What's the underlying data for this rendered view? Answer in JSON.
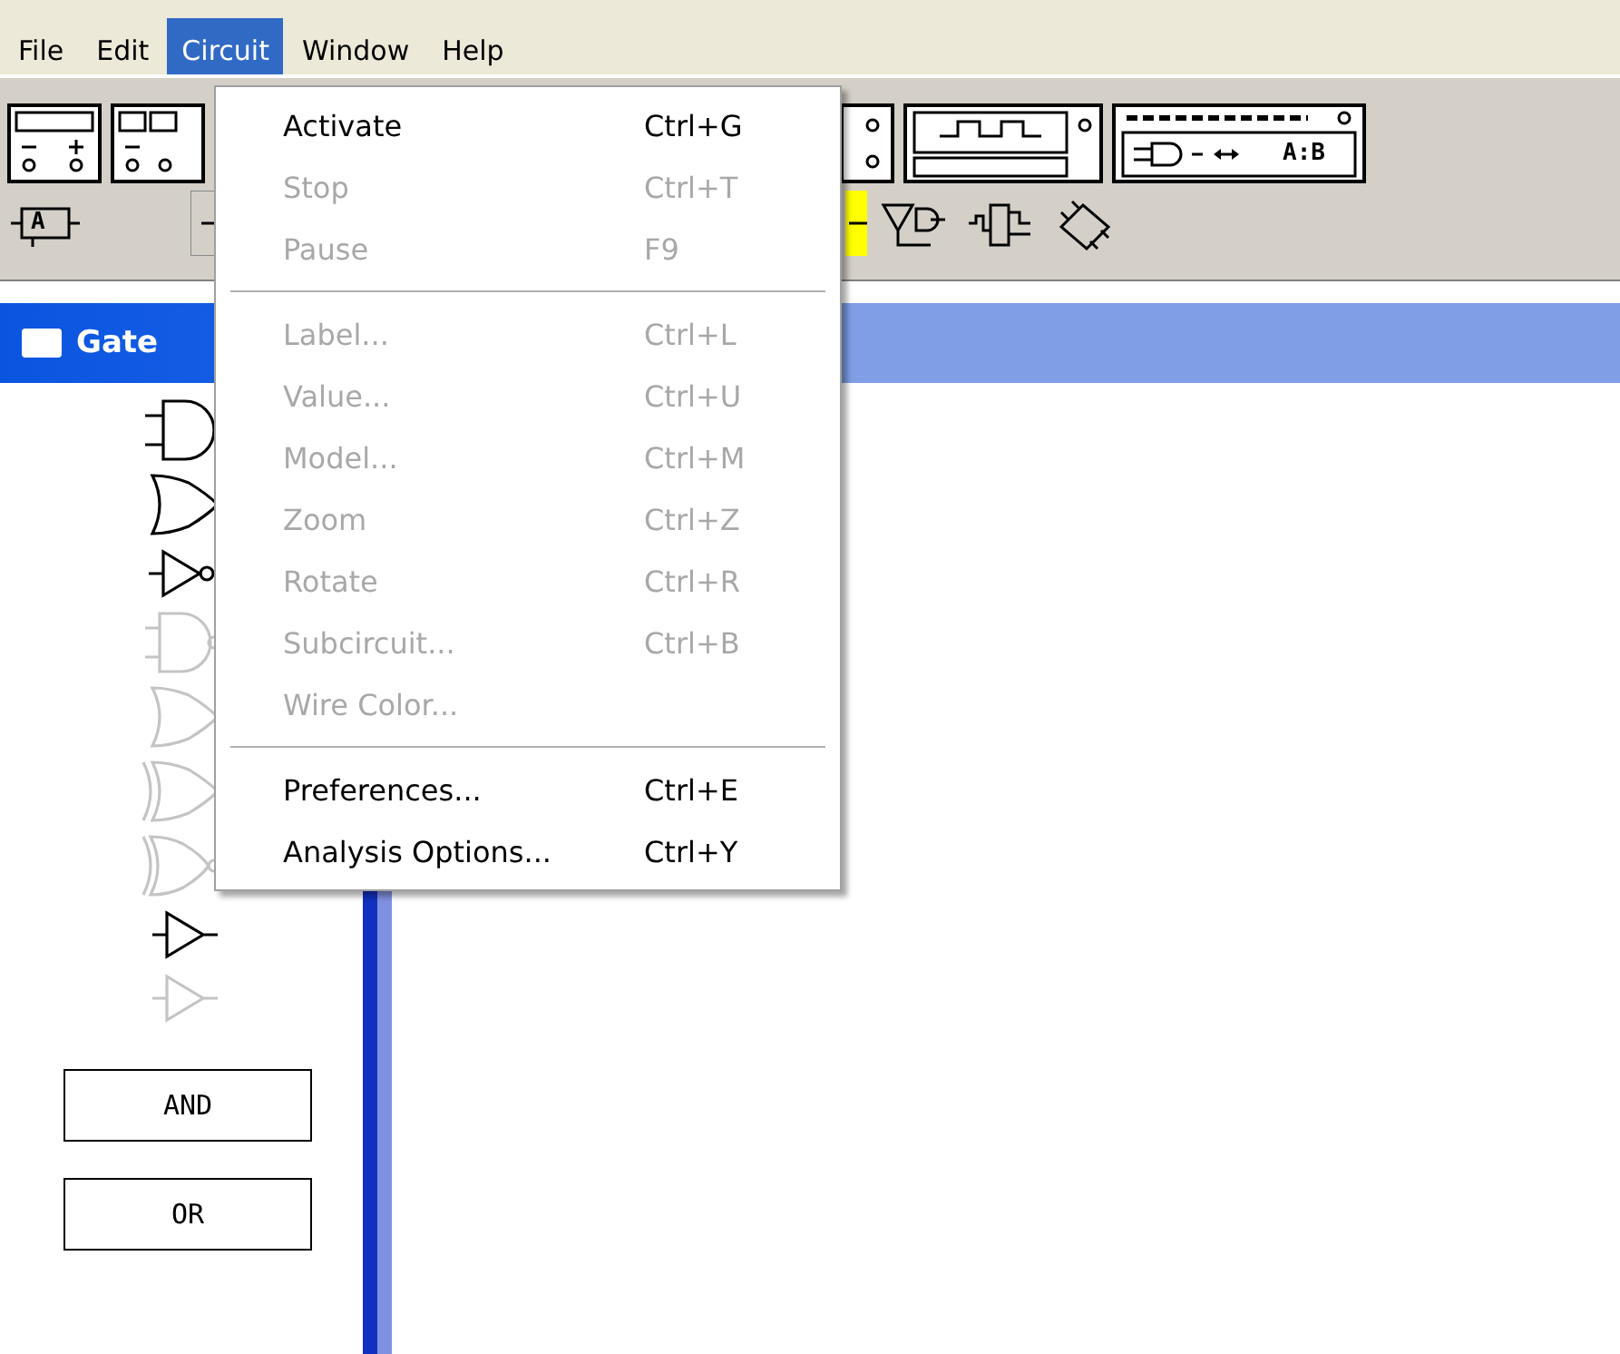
{
  "menubar": [
    {
      "label": "File",
      "selected": false
    },
    {
      "label": "Edit",
      "selected": false
    },
    {
      "label": "Circuit",
      "selected": true
    },
    {
      "label": "Window",
      "selected": false
    },
    {
      "label": "Help",
      "selected": false
    }
  ],
  "toolbar": {
    "row_1": [
      {
        "kind": "battery"
      },
      {
        "kind": "meters"
      },
      {
        "kind": "gap"
      },
      {
        "kind": "probe"
      },
      {
        "kind": "scope"
      },
      {
        "kind": "converter",
        "label": "A:B"
      }
    ],
    "row_2": [
      {
        "kind": "chip",
        "label": "A"
      },
      {
        "kind": "stub"
      },
      {
        "kind": "gap"
      },
      {
        "kind": "yellow"
      },
      {
        "kind": "gates"
      },
      {
        "kind": "flipflop"
      },
      {
        "kind": "ic"
      }
    ]
  },
  "panel": {
    "title": "Gate",
    "gates": [
      {
        "kind": "and",
        "disabled": false
      },
      {
        "kind": "or",
        "disabled": false
      },
      {
        "kind": "not",
        "disabled": false
      },
      {
        "kind": "nand",
        "disabled": true
      },
      {
        "kind": "or",
        "disabled": true
      },
      {
        "kind": "xor",
        "disabled": true
      },
      {
        "kind": "xnor",
        "disabled": true
      },
      {
        "kind": "buffer",
        "disabled": false
      },
      {
        "kind": "buffer",
        "disabled": true
      }
    ],
    "blocks": [
      "AND",
      "OR"
    ]
  },
  "menu": {
    "groups": [
      [
        {
          "label": "Activate",
          "shortcut": "Ctrl+G",
          "disabled": false
        },
        {
          "label": "Stop",
          "shortcut": "Ctrl+T",
          "disabled": true
        },
        {
          "label": "Pause",
          "shortcut": "F9",
          "disabled": true
        }
      ],
      [
        {
          "label": "Label...",
          "shortcut": "Ctrl+L",
          "disabled": true
        },
        {
          "label": "Value...",
          "shortcut": "Ctrl+U",
          "disabled": true
        },
        {
          "label": "Model...",
          "shortcut": "Ctrl+M",
          "disabled": true
        },
        {
          "label": "Zoom",
          "shortcut": "Ctrl+Z",
          "disabled": true
        },
        {
          "label": "Rotate",
          "shortcut": "Ctrl+R",
          "disabled": true
        },
        {
          "label": "Subcircuit...",
          "shortcut": "Ctrl+B",
          "disabled": true
        },
        {
          "label": "Wire Color...",
          "disabled": true
        }
      ],
      [
        {
          "label": "Preferences...",
          "shortcut": "Ctrl+E",
          "disabled": false
        },
        {
          "label": "Analysis Options...",
          "shortcut": "Ctrl+Y",
          "disabled": false
        }
      ]
    ]
  }
}
